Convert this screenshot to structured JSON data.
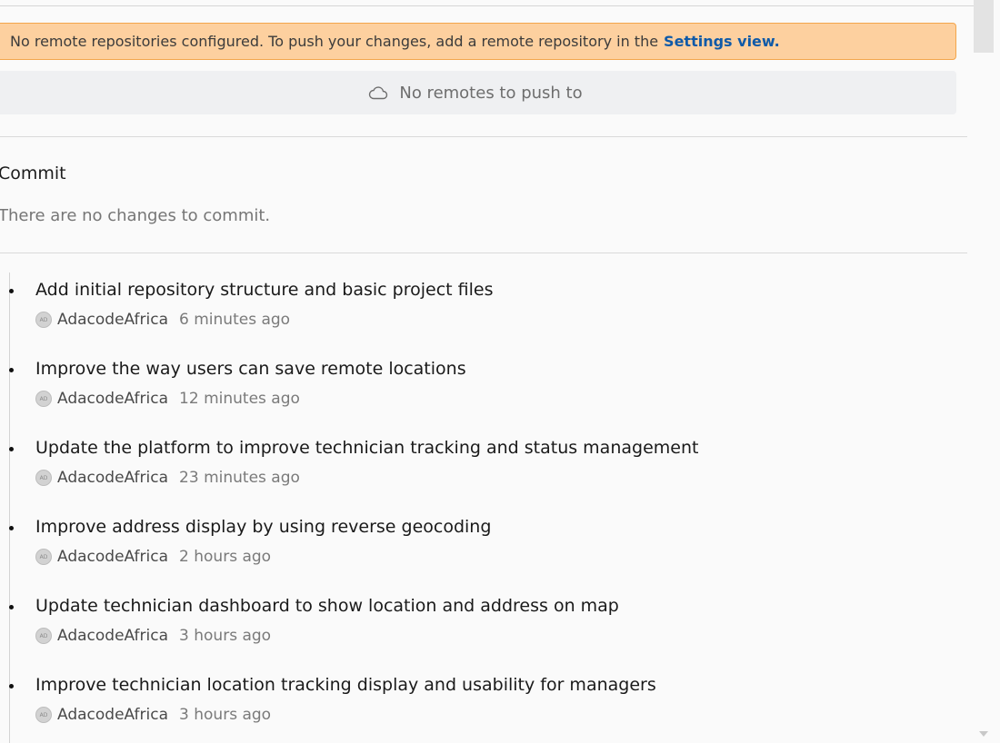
{
  "warning": {
    "text": "No remote repositories configured. To push your changes, add a remote repository in the",
    "link": "Settings view."
  },
  "push": {
    "label": "No remotes to push to",
    "icon": "cloud-icon"
  },
  "commit_section": {
    "title": "Commit",
    "empty_note": "There are no changes to commit."
  },
  "history": {
    "avatar_initials": "AD",
    "commits": [
      {
        "message": "Add initial repository structure and basic project files",
        "author": "AdacodeAfrica",
        "time": "6 minutes ago"
      },
      {
        "message": "Improve the way users can save remote locations",
        "author": "AdacodeAfrica",
        "time": "12 minutes ago"
      },
      {
        "message": "Update the platform to improve technician tracking and status management",
        "author": "AdacodeAfrica",
        "time": "23 minutes ago"
      },
      {
        "message": "Improve address display by using reverse geocoding",
        "author": "AdacodeAfrica",
        "time": "2 hours ago"
      },
      {
        "message": "Update technician dashboard to show location and address on map",
        "author": "AdacodeAfrica",
        "time": "3 hours ago"
      },
      {
        "message": "Improve technician location tracking display and usability for managers",
        "author": "AdacodeAfrica",
        "time": "3 hours ago"
      }
    ]
  },
  "colors": {
    "warning_bg": "#fdd09f",
    "warning_border": "#f3a64c",
    "link": "#0f5aa8",
    "push_bg": "#eff0f2"
  }
}
